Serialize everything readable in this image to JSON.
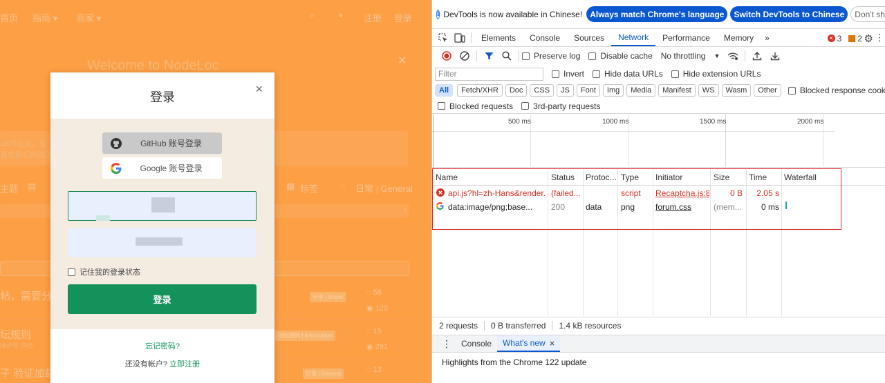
{
  "site": {
    "nav": {
      "home": "首页",
      "guide": "指南",
      "guide_arrow": "▾",
      "merchant": "商家",
      "merchant_arrow": "▾",
      "signup": "注册",
      "login": "登录"
    },
    "background": {
      "welcome_title": "Welcome to NodeLoc",
      "intro_line_1": "vill的站点，在",
      "intro_line_2": "喜欢我们的资源",
      "sidebar_label": "主题",
      "tags_label": "标签",
      "category_label": "日常 | General",
      "item_1": "帖，需要分",
      "item_2": "坛规则",
      "item_2_sub": "维护者·开始",
      "item_3": "子 验证加载",
      "tag_1": "分享 | Share",
      "tag_2": "论坛规则 | Information",
      "tag_3": "日常 | General",
      "stat_1a": "56",
      "stat_1b": "120",
      "stat_2a": "15",
      "stat_2b": "291",
      "stat_3a": "13"
    },
    "login_modal": {
      "title": "登录",
      "close": "×",
      "github_label": "GitHub 账号登录",
      "google_label": "Google 账号登录",
      "remember_label": "记住我的登录状态",
      "submit_label": "登录",
      "forgot_link": "忘记密码?",
      "no_account_text": "还没有帐户?",
      "signup_link": "立即注册"
    },
    "colors": {
      "overlay": "#fd9f45",
      "accent": "#13925c"
    }
  },
  "devtools": {
    "infobar": {
      "text": "DevTools is now available in Chinese!",
      "match_button": "Always match Chrome's language",
      "switch_button": "Switch DevTools to Chinese",
      "dismiss_button": "Don't show again"
    },
    "tabs": [
      "Elements",
      "Console",
      "Sources",
      "Network",
      "Performance",
      "Memory"
    ],
    "more_tabs": "»",
    "active_tab": "Network",
    "errors_count": "3",
    "warnings_count": "2",
    "toolbar": {
      "preserve_log": "Preserve log",
      "disable_cache": "Disable cache",
      "throttling": "No throttling"
    },
    "filter": {
      "placeholder": "Filter",
      "invert": "Invert",
      "hide_data_urls": "Hide data URLs",
      "hide_extension_urls": "Hide extension URLs"
    },
    "type_filters": [
      "All",
      "Fetch/XHR",
      "Doc",
      "CSS",
      "JS",
      "Font",
      "Img",
      "Media",
      "Manifest",
      "WS",
      "Wasm",
      "Other"
    ],
    "blocked_response_cookies": "Blocked response cookies",
    "blocked_requests": "Blocked requests",
    "third_party_requests": "3rd-party requests",
    "overview_ticks": [
      "500 ms",
      "1000 ms",
      "1500 ms",
      "2000 ms"
    ],
    "table": {
      "columns": [
        "Name",
        "Status",
        "Protoc...",
        "Type",
        "Initiator",
        "Size",
        "Time",
        "Waterfall"
      ],
      "rows": [
        {
          "name": "api.js?hl=zh-Hans&render...",
          "status": "(failed...",
          "protocol": "",
          "type": "script",
          "initiator": "Recaptcha.js:8",
          "size": "0 B",
          "time": "2.05 s",
          "failed": true
        },
        {
          "name": "data:image/png;base...",
          "status": "200",
          "protocol": "data",
          "type": "png",
          "initiator": "forum.css",
          "size": "(mem...",
          "time": "0 ms",
          "failed": false
        }
      ]
    },
    "status_bar": {
      "requests": "2 requests",
      "transferred": "0 B transferred",
      "resources": "1.4 kB resources"
    },
    "drawer": {
      "tabs": [
        "Console",
        "What's new"
      ],
      "active": "What's new",
      "close": "×",
      "content": "Highlights from the Chrome 122 update"
    },
    "colors": {
      "accent": "#0b57d0",
      "error": "#d93025",
      "highlight": "#e0292b"
    }
  }
}
